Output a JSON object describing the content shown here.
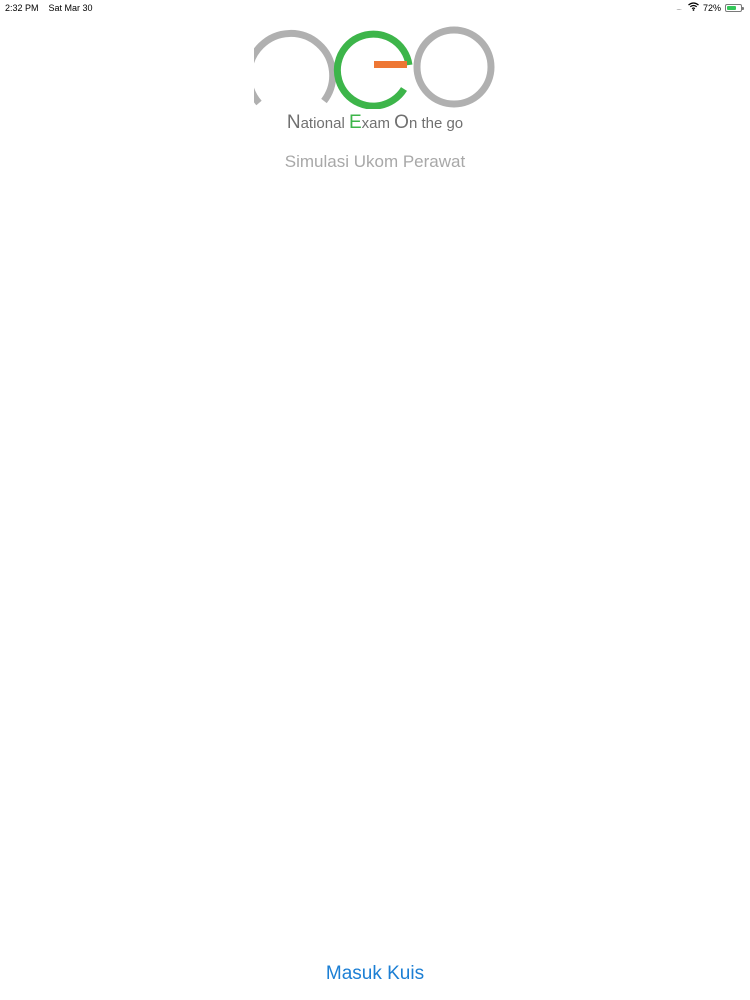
{
  "status_bar": {
    "time": "2:32 PM",
    "date": "Sat Mar 30",
    "signal_icon": "signal-dots-icon",
    "wifi_icon": "wifi-icon",
    "battery_percent": "72%",
    "battery_level": 0.72,
    "battery_icon": "battery-charging-icon",
    "battery_color": "#34c759"
  },
  "logo": {
    "icon": "neo-logo",
    "colors": {
      "gray": "#b0b0b0",
      "green": "#3db54a",
      "orange": "#ee7734"
    }
  },
  "tagline": {
    "part1_initial": "N",
    "part1_rest": "ational ",
    "part2_initial": "E",
    "part2_rest": "xam ",
    "part3_initial": "O",
    "part3_rest": "n the go"
  },
  "subtitle": "Simulasi Ukom Perawat",
  "action": {
    "label": "Masuk Kuis",
    "color": "#1c7fd4"
  }
}
